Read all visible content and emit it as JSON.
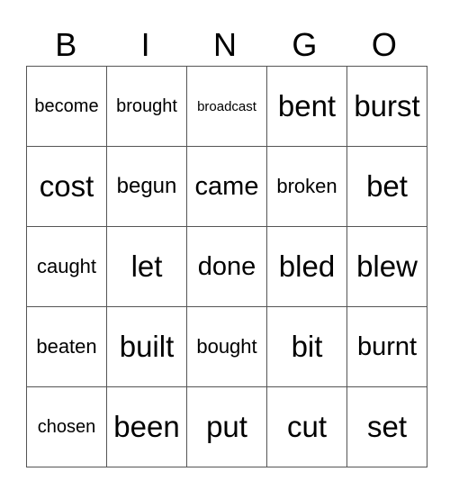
{
  "header": [
    "B",
    "I",
    "N",
    "G",
    "O"
  ],
  "rows": [
    [
      "become",
      "brought",
      "broadcast",
      "bent",
      "burst"
    ],
    [
      "cost",
      "begun",
      "came",
      "broken",
      "bet"
    ],
    [
      "caught",
      "let",
      "done",
      "bled",
      "blew"
    ],
    [
      "beaten",
      "built",
      "bought",
      "bit",
      "burnt"
    ],
    [
      "chosen",
      "been",
      "put",
      "cut",
      "set"
    ]
  ],
  "colors": {
    "grid_line": "#555555",
    "text": "#000000",
    "background": "#ffffff"
  }
}
